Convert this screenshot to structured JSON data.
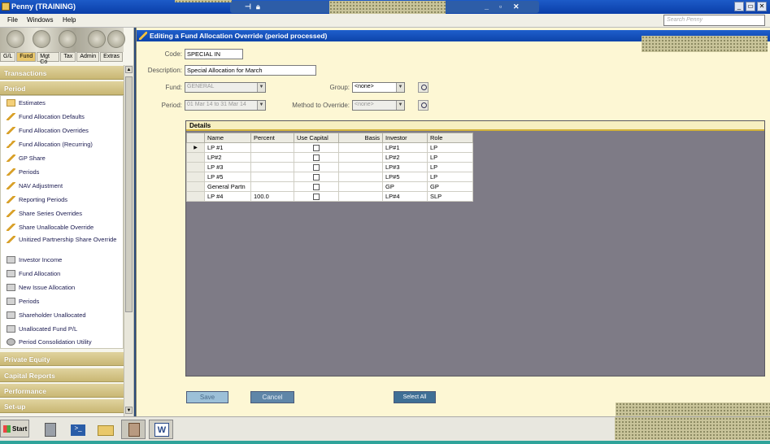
{
  "window": {
    "title": "Penny (TRAINING)"
  },
  "menu": {
    "file": "File",
    "windows": "Windows",
    "help": "Help",
    "search_placeholder": "Search Penny"
  },
  "sidebar": {
    "tabs": [
      "G/L",
      "Fund",
      "Mgt Co",
      "Tax",
      "Admin",
      "Extras"
    ],
    "active_tab": "Fund",
    "sections": {
      "transactions": "Transactions",
      "period": "Period",
      "private_equity": "Private Equity",
      "capital_reports": "Capital Reports",
      "performance": "Performance",
      "setup": "Set-up"
    },
    "items": [
      {
        "label": "Estimates",
        "icon": "folder-icon"
      },
      {
        "label": "Fund Allocation Defaults",
        "icon": "pencil-icon"
      },
      {
        "label": "Fund Allocation Overrides",
        "icon": "pencil-icon"
      },
      {
        "label": "Fund Allocation (Recurring)",
        "icon": "pencil-icon"
      },
      {
        "label": "GP Share",
        "icon": "pencil-icon"
      },
      {
        "label": "Periods",
        "icon": "pencil-icon"
      },
      {
        "label": "NAV Adjustment",
        "icon": "pencil-icon"
      },
      {
        "label": "Reporting Periods",
        "icon": "pencil-icon"
      },
      {
        "label": "Share Series Overrides",
        "icon": "pencil-icon"
      },
      {
        "label": "Share Unallocable Override",
        "icon": "pencil-icon"
      },
      {
        "label": "Unitized Partnership Share Override",
        "icon": "pencil-icon"
      },
      {
        "label": "Investor Income",
        "icon": "printer-icon"
      },
      {
        "label": "Fund Allocation",
        "icon": "printer-icon"
      },
      {
        "label": "New Issue Allocation",
        "icon": "printer-icon"
      },
      {
        "label": "Periods",
        "icon": "printer-icon"
      },
      {
        "label": "Shareholder Unallocated",
        "icon": "printer-icon"
      },
      {
        "label": "Unallocated Fund P/L",
        "icon": "printer-icon"
      },
      {
        "label": "Period Consolidation Utility",
        "icon": "gear-icon"
      }
    ]
  },
  "form": {
    "title": "Editing a Fund Allocation Override (period processed)",
    "code_label": "Code:",
    "code_value": "SPECIAL IN",
    "description_label": "Description:",
    "description_value": "Special Allocation for March",
    "fund_label": "Fund:",
    "fund_value": "GENERAL",
    "group_label": "Group:",
    "group_value": "<none>",
    "period_label": "Period:",
    "period_value": "01 Mar 14 to 31 Mar 14",
    "method_label": "Method to Override:",
    "method_value": "<none>"
  },
  "details": {
    "header": "Details",
    "columns": [
      "Name",
      "Percent",
      "Use Capital",
      "Basis",
      "Investor",
      "Role"
    ],
    "rows": [
      {
        "name": "LP #1",
        "percent": "",
        "basis": "",
        "investor": "LP#1",
        "role": "LP",
        "current": true
      },
      {
        "name": "LP#2",
        "percent": "",
        "basis": "",
        "investor": "LP#2",
        "role": "LP"
      },
      {
        "name": "LP #3",
        "percent": "",
        "basis": "",
        "investor": "LP#3",
        "role": "LP"
      },
      {
        "name": "LP #5",
        "percent": "",
        "basis": "",
        "investor": "LP#5",
        "role": "LP"
      },
      {
        "name": "General Partn",
        "percent": "",
        "basis": "",
        "investor": "GP",
        "role": "GP"
      },
      {
        "name": "LP #4",
        "percent": "100.0",
        "basis": "",
        "investor": "LP#4",
        "role": "SLP"
      }
    ]
  },
  "buttons": {
    "save": "Save",
    "cancel": "Cancel",
    "select_all": "Select All"
  },
  "taskbar": {
    "start": "Start"
  },
  "colors": {
    "title_blue": "#0d44aa",
    "form_bg": "#fdf7d4",
    "details_bg": "#7e7b86",
    "nav_gold": "#c9b774"
  }
}
